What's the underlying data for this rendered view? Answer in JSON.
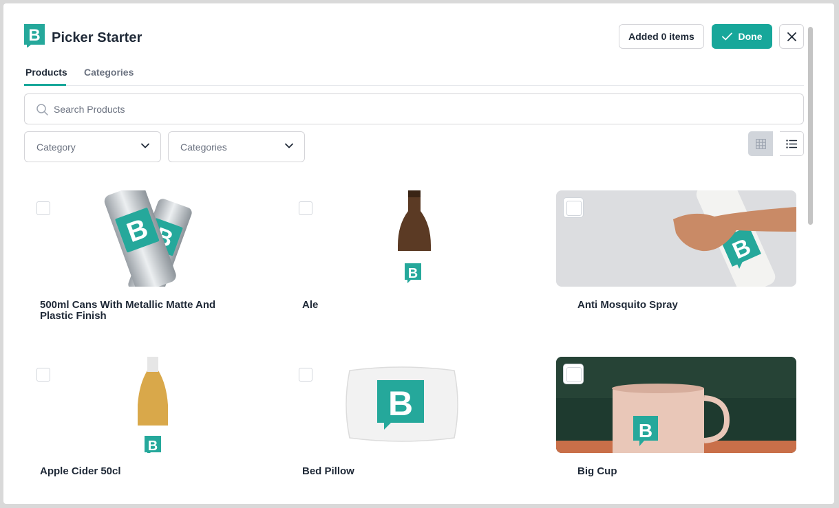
{
  "header": {
    "title": "Picker Starter",
    "added_label": "Added 0 items",
    "done_label": "Done"
  },
  "tabs": [
    {
      "label": "Products",
      "active": true
    },
    {
      "label": "Categories",
      "active": false
    }
  ],
  "search": {
    "placeholder": "Search Products",
    "value": ""
  },
  "filters": [
    {
      "label": "Category"
    },
    {
      "label": "Categories"
    }
  ],
  "view_mode": "grid",
  "colors": {
    "accent": "#17a79a",
    "brand": "#25a89b"
  },
  "products": [
    {
      "name": "500ml Cans With Metallic Matte And Plastic Finish",
      "checked": false,
      "image": "cans-image"
    },
    {
      "name": "Ale",
      "checked": false,
      "image": "ale-bottle-image"
    },
    {
      "name": "Anti Mosquito Spray",
      "checked": false,
      "image": "spray-hand-image"
    },
    {
      "name": "Apple Cider 50cl",
      "checked": false,
      "image": "cider-bottle-image"
    },
    {
      "name": "Bed Pillow",
      "checked": false,
      "image": "pillow-image"
    },
    {
      "name": "Big Cup",
      "checked": false,
      "image": "enamel-cup-image"
    }
  ]
}
